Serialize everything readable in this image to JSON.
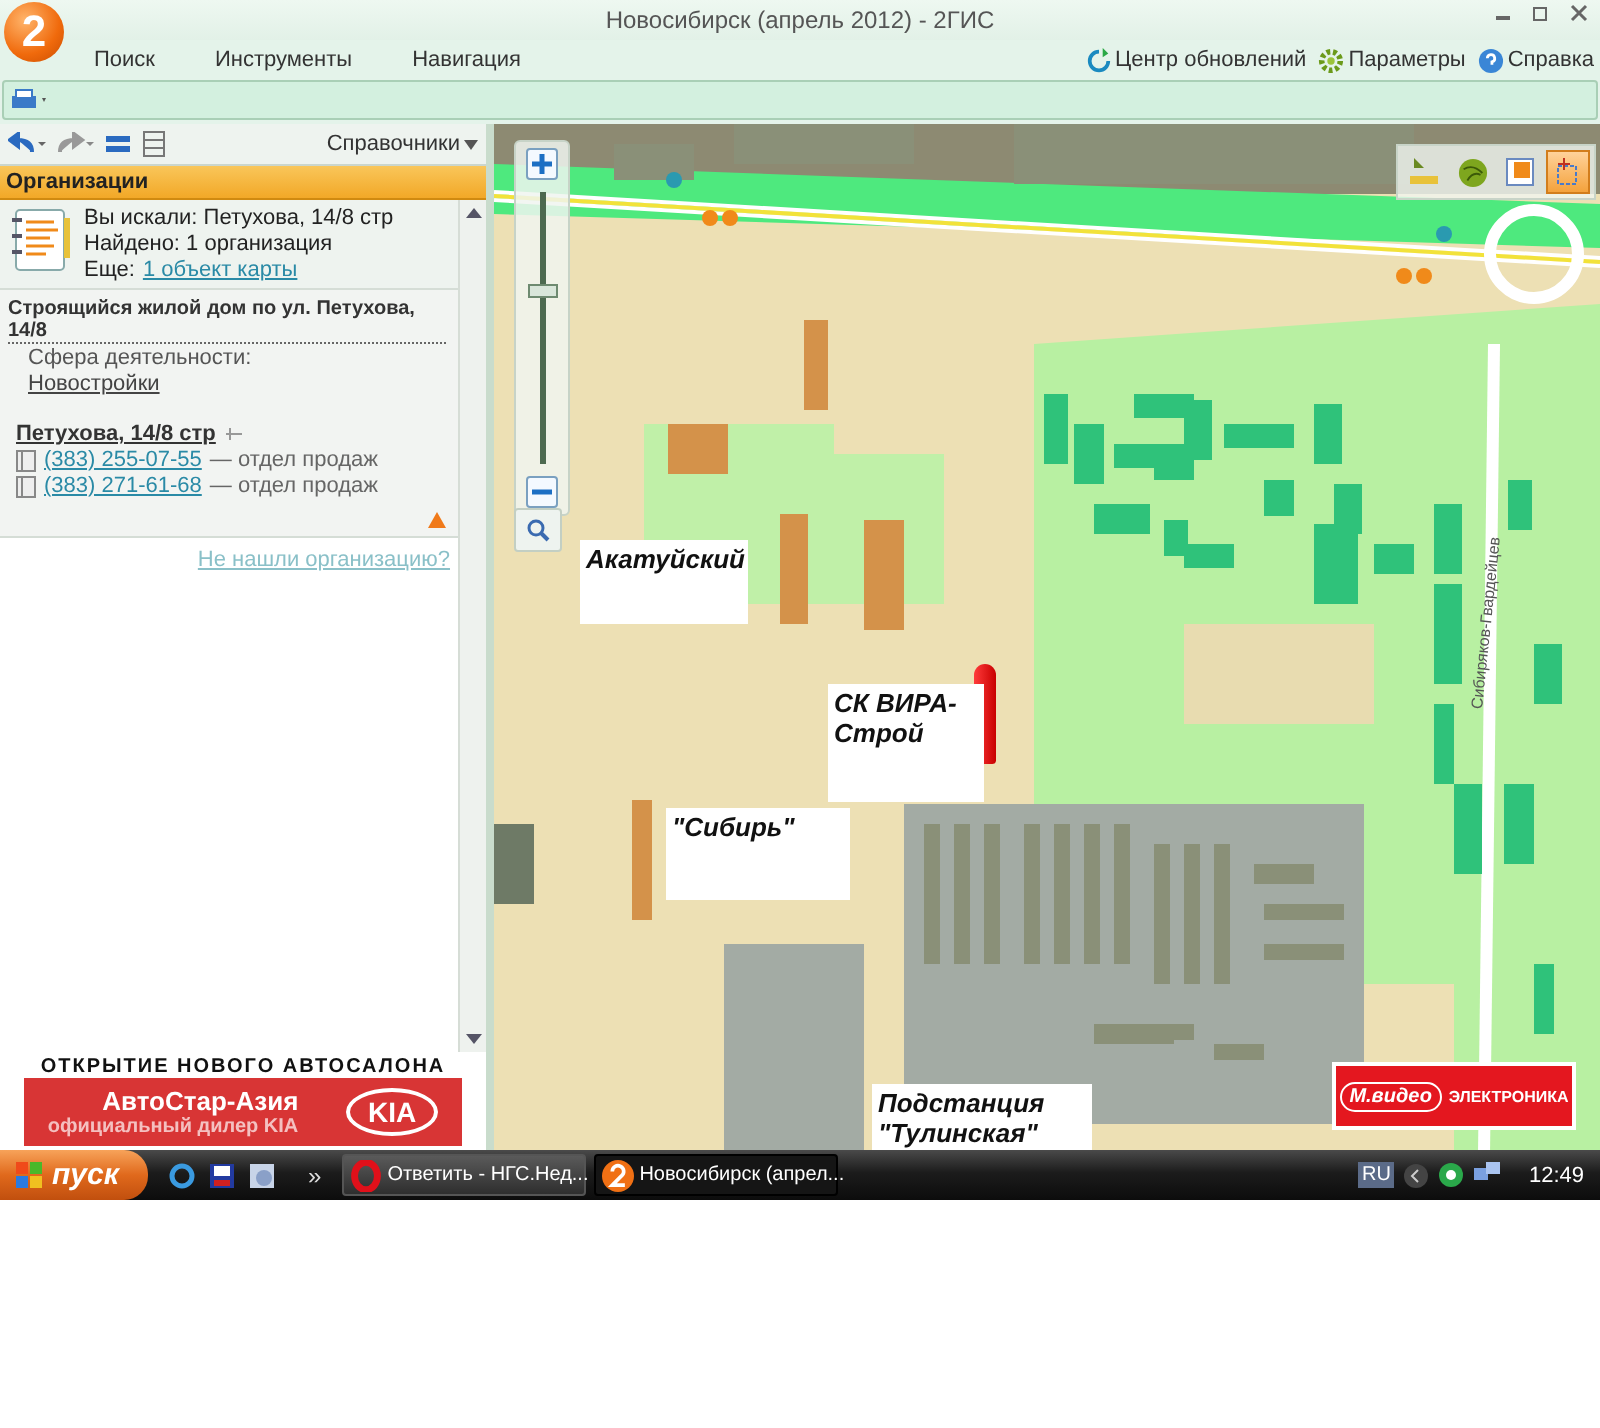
{
  "window": {
    "logo": "2",
    "title": "Новосибирск (апрель 2012) - 2ГИС"
  },
  "menu": [
    "Поиск",
    "Инструменты",
    "Навигация"
  ],
  "menu_right": [
    {
      "kind": "update",
      "label": "Центр обновлений"
    },
    {
      "kind": "settings",
      "label": "Параметры"
    },
    {
      "kind": "help",
      "label": "Справка"
    }
  ],
  "panel": {
    "catalog_button": "Справочники",
    "header": "Организации",
    "search_summary": {
      "query": "Вы искали: Петухова, 14/8 стр",
      "found": "Найдено: 1 организация",
      "more_label": "Еще:",
      "more_link": "1 объект карты"
    },
    "organization": {
      "name": "Строящийся жилой дом по ул. Петухова, 14/8",
      "activity_label": "Сфера деятельности:",
      "activity_link": "Новостройки",
      "address": "Петухова, 14/8 стр",
      "phones": [
        {
          "number": "(383) 255-07-55",
          "note": "— отдел продаж"
        },
        {
          "number": "(383) 271-61-68",
          "note": "— отдел продаж"
        }
      ]
    },
    "not_found_link": "Не нашли организацию?"
  },
  "ad": {
    "headline": "ОТКРЫТИЕ НОВОГО АВТОСАЛОНА",
    "brand": "АвтоСтар-Азия",
    "subline": "официальный дилер KIA",
    "logo": "KIA"
  },
  "map": {
    "zoom": {
      "level": 0.63
    },
    "tools": [
      {
        "kind": "ruler",
        "selected": false
      },
      {
        "kind": "globe",
        "selected": false
      },
      {
        "kind": "layer",
        "selected": false
      },
      {
        "kind": "select",
        "selected": true
      }
    ],
    "labels": [
      {
        "text": "Акатуйский"
      },
      {
        "text": "СК ВИРА-Строй"
      },
      {
        "text": "\"Сибирь\""
      },
      {
        "text": "Подстанция \"Тулинская\""
      }
    ],
    "street": "Сибиряков-Гвардейцев",
    "banner": {
      "logo": "М.видео",
      "text": "ЭЛЕКТРОНИКА"
    }
  },
  "taskbar": {
    "start": "пуск",
    "more": "»",
    "tasks": [
      {
        "kind": "browser",
        "label": "Ответить - НГС.Нед...",
        "selected": false
      },
      {
        "kind": "app",
        "label": "Новосибирск (апрел...",
        "selected": true
      }
    ],
    "language": "RU",
    "time": "12:49"
  }
}
